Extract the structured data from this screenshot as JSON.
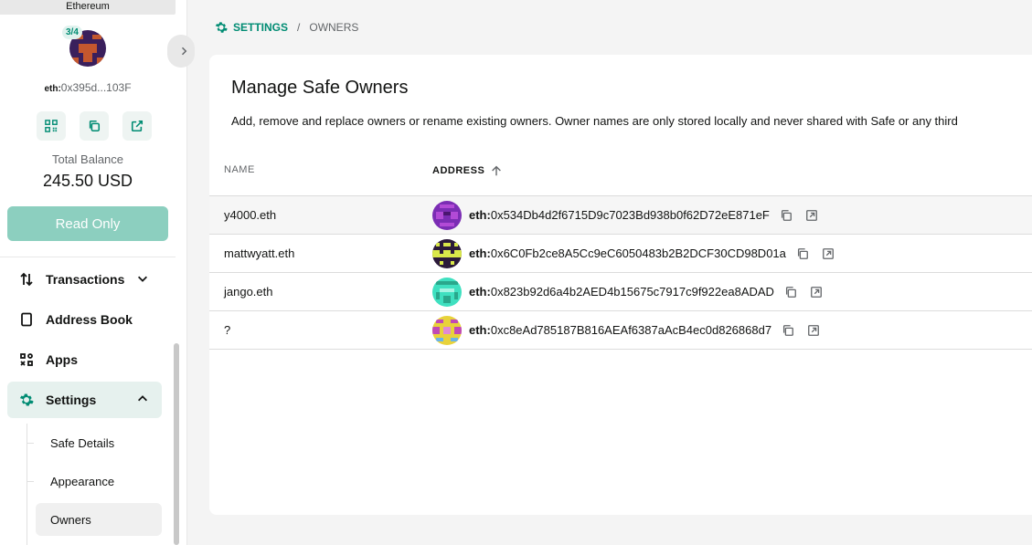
{
  "sidebar": {
    "network": "Ethereum",
    "threshold": "3/4",
    "address_prefix": "eth:",
    "address_short": "0x395d...103F",
    "balance_label": "Total Balance",
    "balance_value": "245.50 USD",
    "read_only": "Read Only",
    "nav": {
      "transactions": "Transactions",
      "address_book": "Address Book",
      "apps": "Apps",
      "settings": "Settings"
    },
    "settings_sub": {
      "safe_details": "Safe Details",
      "appearance": "Appearance",
      "owners": "Owners"
    }
  },
  "breadcrumb": {
    "section": "SETTINGS",
    "separator": "/",
    "page": "OWNERS"
  },
  "card": {
    "title": "Manage Safe Owners",
    "description": "Add, remove and replace owners or rename existing owners. Owner names are only stored locally and never shared with Safe or any third",
    "columns": {
      "name": "NAME",
      "address": "ADDRESS"
    },
    "owners": [
      {
        "name": "y4000.eth",
        "prefix": "eth:",
        "address": "0x534Db4d2f6715D9c7023Bd938b0f62D72eE871eF"
      },
      {
        "name": "mattwyatt.eth",
        "prefix": "eth:",
        "address": "0x6C0Fb2ce8A5Cc9eC6050483b2B2DCF30CD98D01a"
      },
      {
        "name": "jango.eth",
        "prefix": "eth:",
        "address": "0x823b92d6a4b2AED4b15675c7917c9f922ea8ADAD"
      },
      {
        "name": "?",
        "prefix": "eth:",
        "address": "0xc8eAd785187B816AEAf6387aAcB4ec0d826868d7"
      }
    ]
  },
  "colors": {
    "accent": "#008c73",
    "read_only_button": "#8ccfbf",
    "active_nav_bg": "#e6f1ee"
  },
  "icons": {
    "qr": "qr-code-icon",
    "copy": "copy-icon",
    "external": "external-link-icon",
    "transactions": "arrows-swap-icon",
    "address_book": "address-book-icon",
    "apps": "apps-grid-icon",
    "settings": "gear-icon",
    "sort": "arrow-up-icon",
    "collapse": "chevron-right-icon"
  }
}
